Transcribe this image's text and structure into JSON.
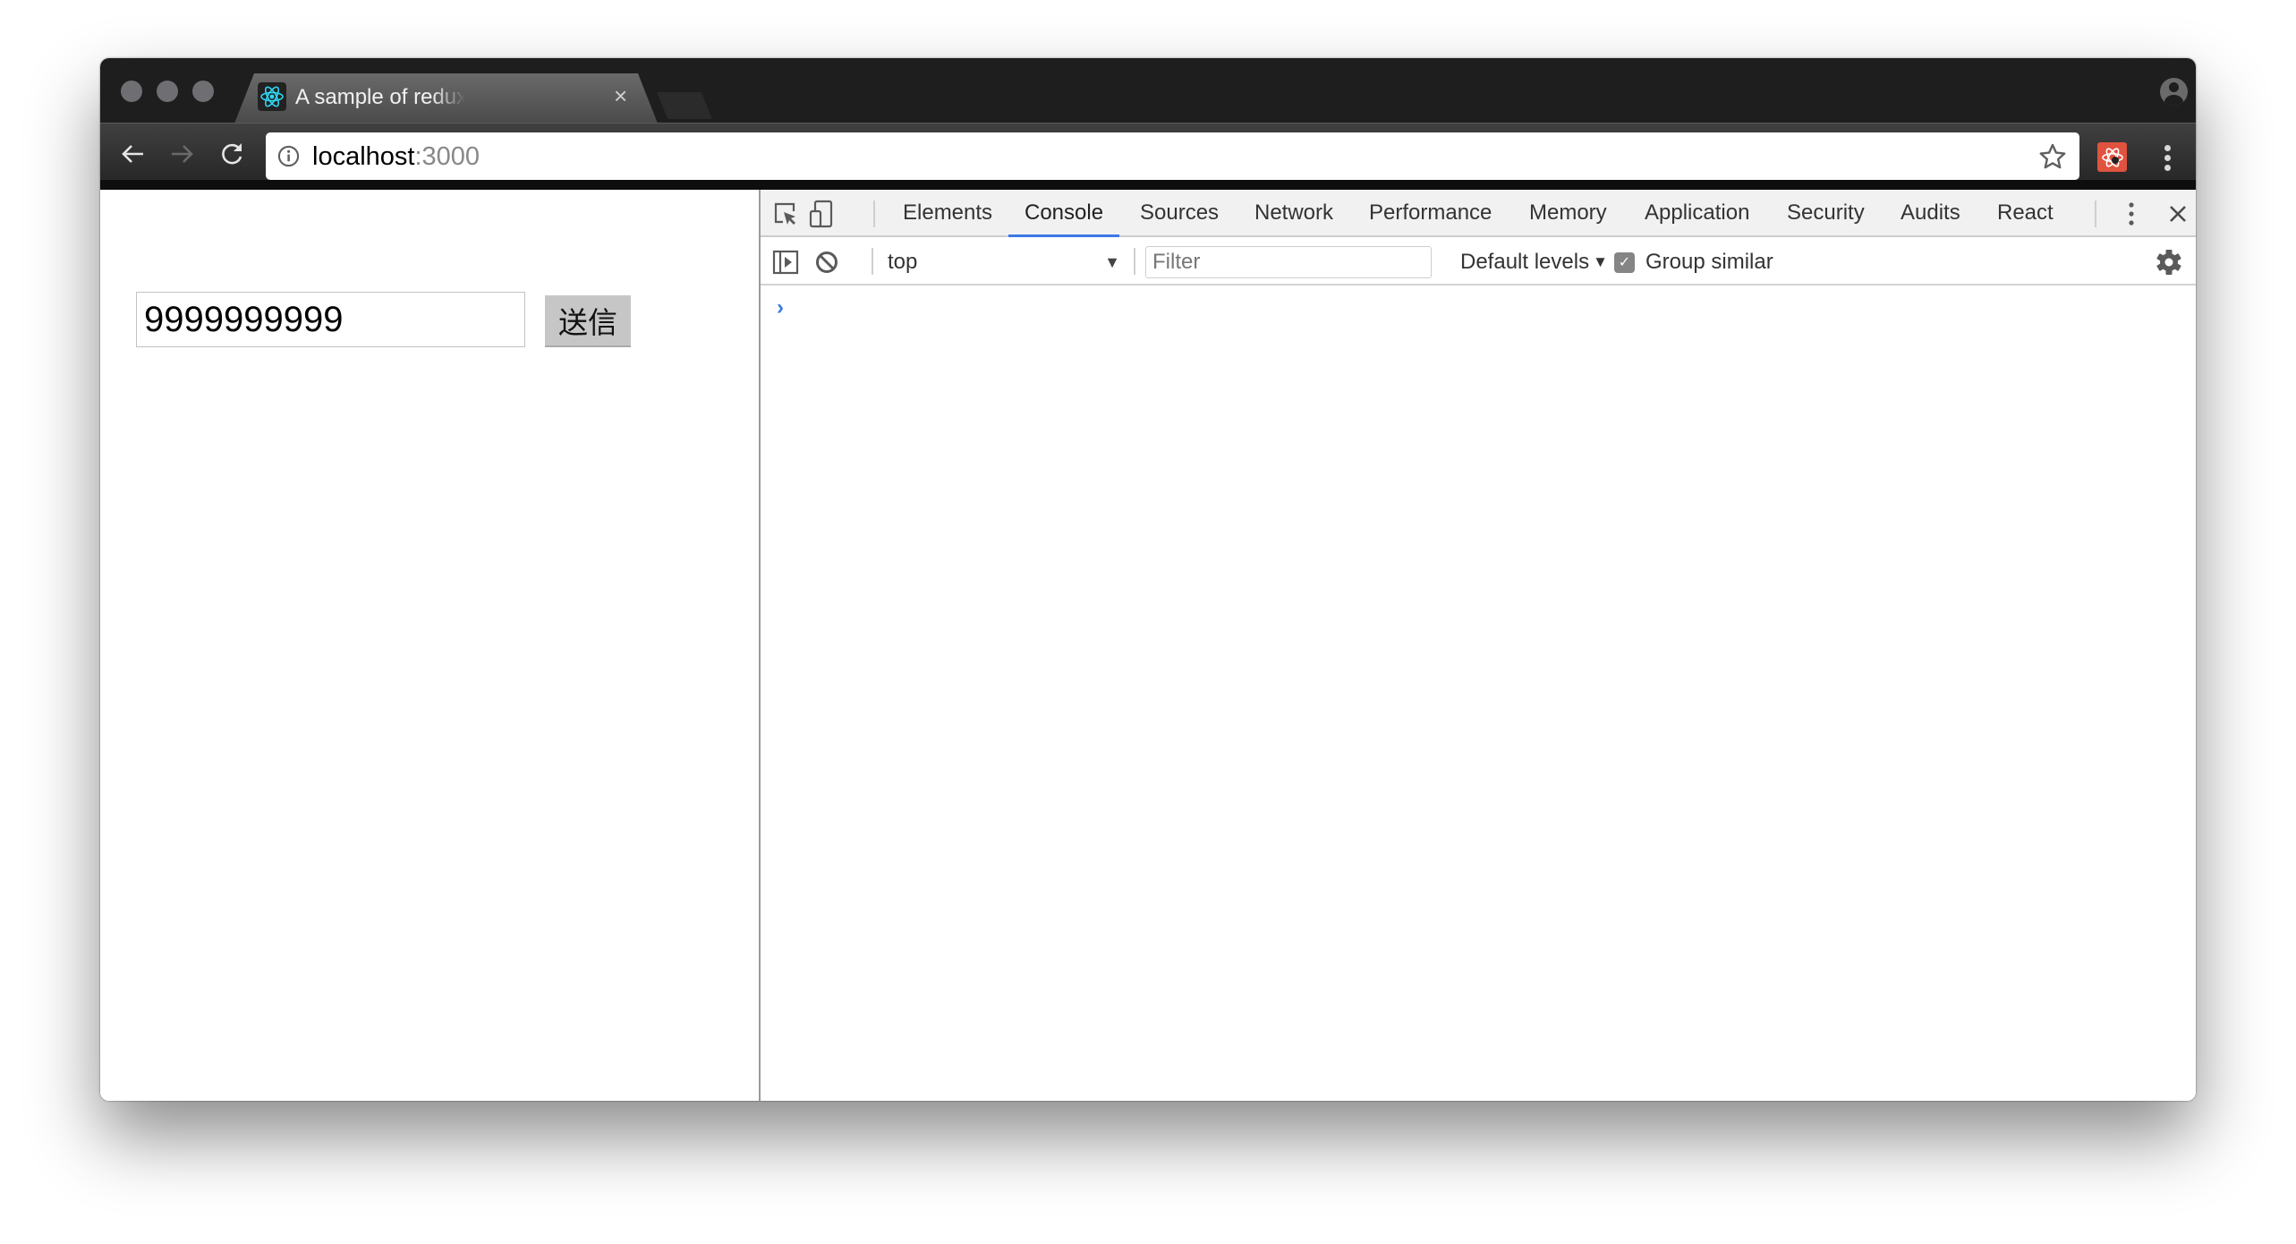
{
  "browser": {
    "tab": {
      "title": "A sample of redux-saga and react",
      "favicon": "react-logo-icon"
    },
    "omnibox": {
      "host": "localhost",
      "port": ":3000"
    },
    "icons": {
      "back": "arrow-left-icon",
      "forward": "arrow-right-icon",
      "reload": "reload-icon",
      "info": "info-icon",
      "bookmark": "star-icon",
      "extension": "react-devtools-extension-icon",
      "menu": "vertical-dots-icon",
      "profile": "user-profile-icon"
    }
  },
  "page": {
    "input_value": "9999999999",
    "submit_label": "送信"
  },
  "devtools": {
    "tabs": [
      {
        "label": "Elements",
        "active": false
      },
      {
        "label": "Console",
        "active": true
      },
      {
        "label": "Sources",
        "active": false
      },
      {
        "label": "Network",
        "active": false
      },
      {
        "label": "Performance",
        "active": false
      },
      {
        "label": "Memory",
        "active": false
      },
      {
        "label": "Application",
        "active": false
      },
      {
        "label": "Security",
        "active": false
      },
      {
        "label": "Audits",
        "active": false
      },
      {
        "label": "React",
        "active": false
      }
    ],
    "console": {
      "context": "top",
      "filter_placeholder": "Filter",
      "levels_label": "Default levels",
      "group_similar_label": "Group similar",
      "group_similar_checked": true,
      "prompt": "›"
    },
    "accent_color": "#3b78e7"
  }
}
